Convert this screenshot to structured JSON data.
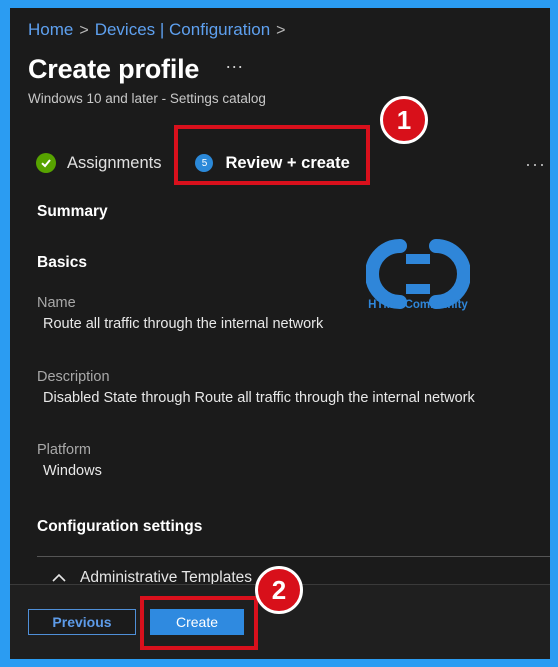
{
  "breadcrumb": {
    "items": [
      "Home",
      "Devices | Configuration"
    ],
    "separator": ">"
  },
  "header": {
    "title": "Create profile",
    "more": "···",
    "subtitle": "Windows 10 and later - Settings catalog"
  },
  "steps": {
    "assignments": "Assignments",
    "review_number": "5",
    "review": "Review + create",
    "more": "···"
  },
  "summary": {
    "heading": "Summary",
    "basics_heading": "Basics",
    "name_label": "Name",
    "name_value": "Route all traffic through the internal network",
    "description_label": "Description",
    "description_value": "Disabled State through Route all traffic through the internal network",
    "platform_label": "Platform",
    "platform_value": "Windows",
    "config_heading": "Configuration settings",
    "admin_templates": "Administrative Templates"
  },
  "footer": {
    "previous": "Previous",
    "create": "Create"
  },
  "annotations": {
    "callout_1": "1",
    "callout_2": "2"
  },
  "watermark": {
    "text": "HTMD Community"
  },
  "colors": {
    "background": "#1b1b1b",
    "page_border": "#2b9cf2",
    "link": "#5ea0ef",
    "primary_button": "#2f8ae0",
    "highlight_red": "#d9101c",
    "success_green": "#57a300"
  },
  "icons": [
    "check-icon",
    "step-number-icon",
    "chevron-right-icon",
    "more-icon",
    "chevron-up-icon"
  ]
}
